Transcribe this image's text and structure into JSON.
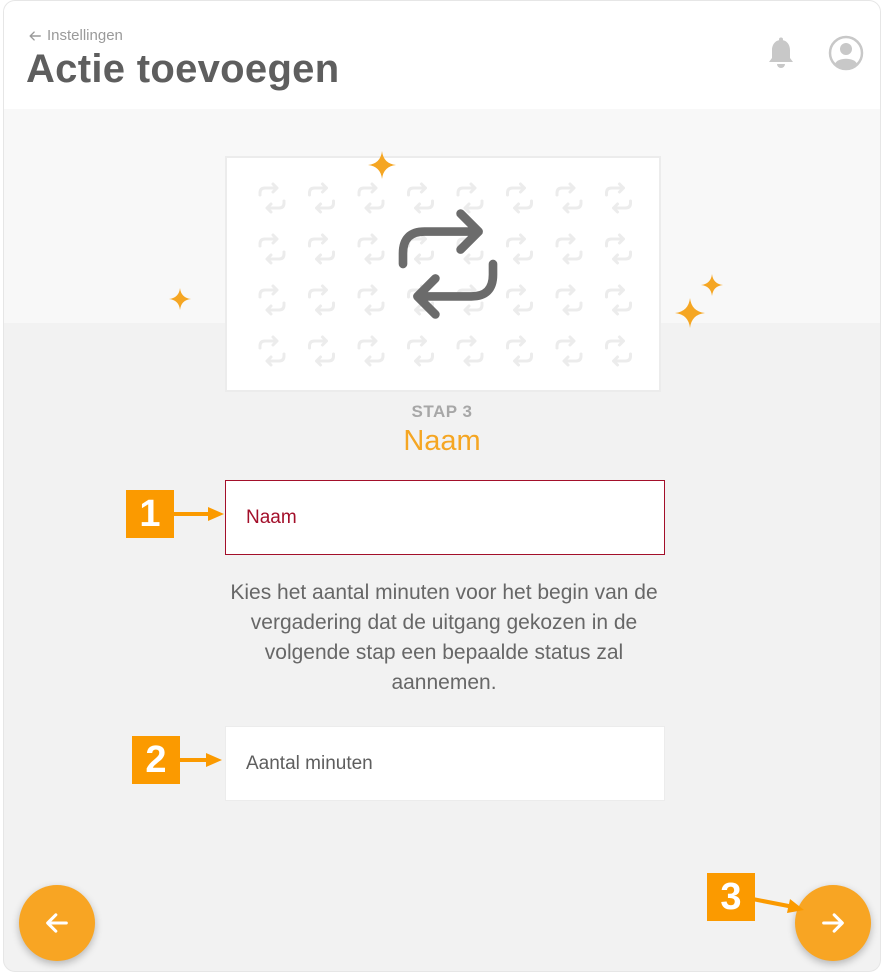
{
  "header": {
    "back_label": "Instellingen",
    "title": "Actie toevoegen",
    "icons": {
      "notifications": "bell-icon",
      "profile": "user-avatar-icon"
    }
  },
  "illustration": {
    "icon": "repeat-icon"
  },
  "step": {
    "label": "STAP 3",
    "title": "Naam"
  },
  "form": {
    "name_placeholder": "Naam",
    "description": "Kies het aantal minuten voor het begin van de vergadering dat de uitgang gekozen in de volgende stap een bepaalde status zal aannemen.",
    "minutes_placeholder": "Aantal minuten"
  },
  "navigation": {
    "prev_icon": "arrow-left-icon",
    "next_icon": "arrow-right-icon"
  },
  "annotations": [
    "1",
    "2",
    "3"
  ],
  "colors": {
    "accent": "#f8a523",
    "error": "#a30f2a",
    "title": "#5e5e5e",
    "badge": "#fb9a00"
  }
}
